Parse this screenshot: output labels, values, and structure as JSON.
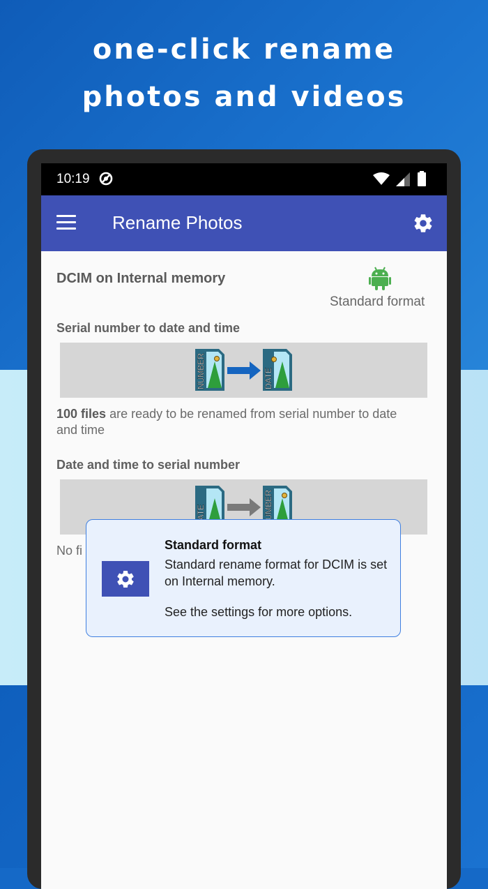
{
  "promo": {
    "line1": "one-click rename",
    "line2": "photos and videos"
  },
  "status_bar": {
    "time": "10:19",
    "icons": [
      "sync-icon",
      "wifi-icon",
      "signal-icon",
      "battery-icon"
    ]
  },
  "app_bar": {
    "title": "Rename Photos",
    "menu_icon": "hamburger-menu-icon",
    "settings_icon": "gear-icon"
  },
  "folder": {
    "title": "DCIM on Internal memory",
    "format_icon": "android-icon",
    "format_label": "Standard format"
  },
  "section1": {
    "title": "Serial number to date and time",
    "from_label": "NUMBER",
    "to_label": "DATE",
    "count": "100 files",
    "description": " are ready to be renamed from serial number to date and time"
  },
  "section2": {
    "title": "Date and time to serial number",
    "from_label": "DATE",
    "to_label": "NUMBER",
    "description": "No fi"
  },
  "popup": {
    "title": "Standard format",
    "body": "Standard rename format for DCIM is set on Internal memory.",
    "more": "See the settings for more options."
  },
  "colors": {
    "primary": "#3f51b5",
    "arrow_active": "#1565c0",
    "arrow_inactive": "#7a7a7a",
    "android_green": "#3ddc84",
    "popup_border": "#3f7fe0"
  }
}
